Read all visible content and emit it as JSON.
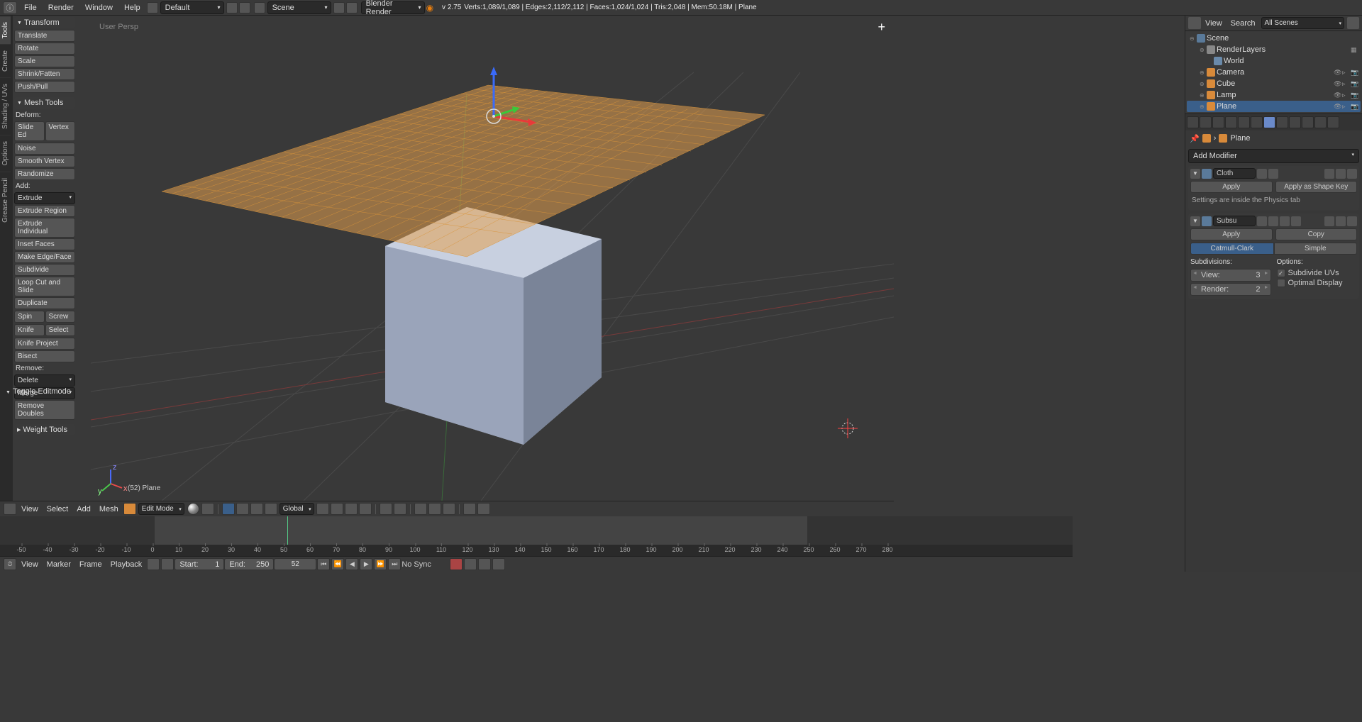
{
  "header": {
    "menus": [
      "File",
      "Render",
      "Window",
      "Help"
    ],
    "layout_label": "Default",
    "scene_label": "Scene",
    "engine_label": "Blender Render",
    "version": "v 2.75",
    "stats": "Verts:1,089/1,089 | Edges:2,112/2,112 | Faces:1,024/1,024 | Tris:2,048 | Mem:50.18M | Plane"
  },
  "vertical_tabs": [
    "Tools",
    "Create",
    "Shading / UVs",
    "Options",
    "Grease Pencil"
  ],
  "transform": {
    "title": "Transform",
    "buttons": [
      "Translate",
      "Rotate",
      "Scale",
      "Shrink/Fatten",
      "Push/Pull"
    ]
  },
  "mesh_tools": {
    "title": "Mesh Tools",
    "deform_label": "Deform:",
    "slide": "Slide Ed",
    "vertex": "Vertex",
    "deform_buttons": [
      "Noise",
      "Smooth Vertex",
      "Randomize"
    ],
    "add_label": "Add:",
    "extrude": "Extrude",
    "add_buttons": [
      "Extrude Region",
      "Extrude Individual",
      "Inset Faces",
      "Make Edge/Face",
      "Subdivide",
      "Loop Cut and Slide",
      "Duplicate"
    ],
    "spin": "Spin",
    "screw": "Screw",
    "knife": "Knife",
    "select": "Select",
    "knife_buttons": [
      "Knife Project",
      "Bisect"
    ],
    "remove_label": "Remove:",
    "delete": "Delete",
    "merge": "Merge",
    "remove_doubles": "Remove Doubles"
  },
  "weight_tools": {
    "title": "Weight Tools"
  },
  "history": {
    "title": "Toggle Editmode"
  },
  "viewport": {
    "persp": "User Persp",
    "info": "(52) Plane"
  },
  "viewport_toolbar": {
    "menus": [
      "View",
      "Select",
      "Add",
      "Mesh"
    ],
    "mode": "Edit Mode",
    "orientation": "Global"
  },
  "outliner_header": {
    "view": "View",
    "search": "Search",
    "filter": "All Scenes"
  },
  "outliner": {
    "scene": "Scene",
    "render_layers": "RenderLayers",
    "world": "World",
    "camera": "Camera",
    "cube": "Cube",
    "lamp": "Lamp",
    "plane": "Plane"
  },
  "breadcrumb": {
    "object": "Plane"
  },
  "modifiers": {
    "add_label": "Add Modifier",
    "cloth": {
      "name": "Cloth",
      "apply": "Apply",
      "apply_shape": "Apply as Shape Key",
      "note": "Settings are inside the Physics tab"
    },
    "subsurf": {
      "name": "Subsu",
      "apply": "Apply",
      "copy": "Copy",
      "catmull": "Catmull-Clark",
      "simple": "Simple",
      "subdivisions_label": "Subdivisions:",
      "view_label": "View:",
      "view_value": "3",
      "render_label": "Render:",
      "render_value": "2",
      "options_label": "Options:",
      "subdivide_uvs": "Subdivide UVs",
      "optimal_display": "Optimal Display"
    }
  },
  "timeline": {
    "menus": [
      "View",
      "Marker",
      "Frame",
      "Playback"
    ],
    "start_label": "Start:",
    "start_value": "1",
    "end_label": "End:",
    "end_value": "250",
    "current": "52",
    "sync": "No Sync",
    "ticks": [
      -50,
      -40,
      -30,
      -20,
      -10,
      0,
      10,
      20,
      30,
      40,
      50,
      60,
      70,
      80,
      90,
      100,
      110,
      120,
      130,
      140,
      150,
      160,
      170,
      180,
      190,
      200,
      210,
      220,
      230,
      240,
      250,
      260,
      270,
      280
    ]
  }
}
